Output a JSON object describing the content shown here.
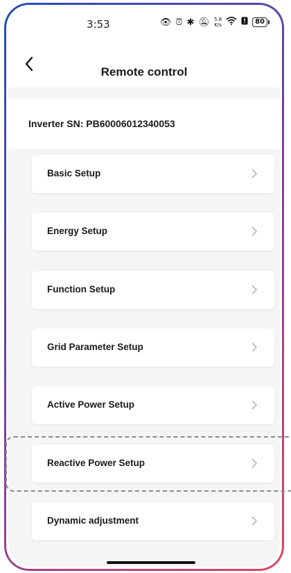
{
  "status_bar": {
    "time": "3:53",
    "net_speed_top": "5.8",
    "net_speed_bottom": "K/s",
    "battery": "80"
  },
  "header": {
    "title": "Remote control",
    "back_icon": "chevron-left-icon"
  },
  "inverter": {
    "sn_label": "Inverter SN: PB60006012340053"
  },
  "menu": {
    "items": [
      {
        "label": "Basic Setup"
      },
      {
        "label": "Energy Setup"
      },
      {
        "label": "Function Setup"
      },
      {
        "label": "Grid Parameter Setup"
      },
      {
        "label": "Active Power Setup"
      },
      {
        "label": "Reactive Power Setup"
      },
      {
        "label": "Dynamic adjustment"
      }
    ]
  },
  "colors": {
    "frame_gradient_start": "#1f4fb5",
    "frame_gradient_end": "#e0445c",
    "background": "#f5f5f5",
    "highlight_dash": "#8a8a8a"
  }
}
